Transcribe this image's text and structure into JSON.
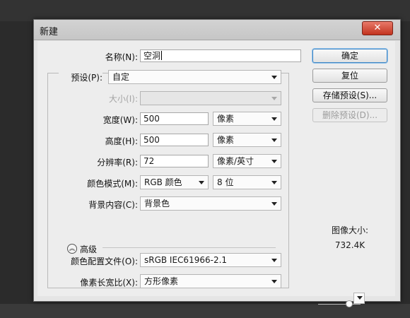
{
  "dialog": {
    "title": "新建",
    "close_icon": "✕"
  },
  "fields": {
    "name": {
      "label": "名称(N):",
      "value": "空洞"
    },
    "preset": {
      "label": "预设(P):",
      "value": "自定"
    },
    "size": {
      "label": "大小(I):",
      "value": ""
    },
    "width": {
      "label": "宽度(W):",
      "value": "500",
      "unit": "像素"
    },
    "height": {
      "label": "高度(H):",
      "value": "500",
      "unit": "像素"
    },
    "resolution": {
      "label": "分辨率(R):",
      "value": "72",
      "unit": "像素/英寸"
    },
    "color_mode": {
      "label": "颜色模式(M):",
      "value": "RGB 颜色",
      "depth": "8 位"
    },
    "background": {
      "label": "背景内容(C):",
      "value": "背景色"
    }
  },
  "advanced": {
    "caret_icon": "︽",
    "label": "高级",
    "color_profile": {
      "label": "颜色配置文件(O):",
      "value": "sRGB IEC61966-2.1"
    },
    "pixel_aspect": {
      "label": "像素长宽比(X):",
      "value": "方形像素"
    }
  },
  "buttons": {
    "ok": "确定",
    "reset": "复位",
    "save_preset": "存储预设(S)...",
    "delete_preset": "删除预设(D)..."
  },
  "image_size": {
    "label": "图像大小:",
    "value": "732.4K"
  },
  "colors": {
    "primary_border": "#3f86c4",
    "close_button": "#c2331e"
  }
}
